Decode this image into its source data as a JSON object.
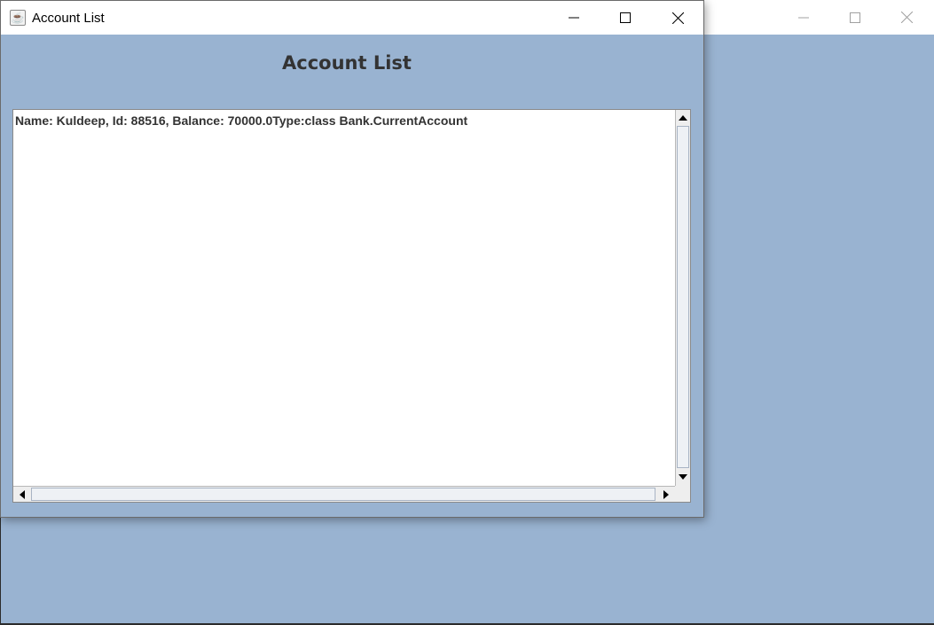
{
  "background_window": {
    "controls": [
      "minimize",
      "maximize",
      "close"
    ]
  },
  "window": {
    "title": "Account List",
    "icon": "java-coffee-icon",
    "controls": {
      "minimize_icon": "minimize-icon",
      "maximize_icon": "maximize-icon",
      "close_icon": "close-icon"
    }
  },
  "content": {
    "heading": "Account List",
    "accounts_text": "Name: Kuldeep, Id: 88516, Balance: 70000.0Type:class Bank.CurrentAccount"
  },
  "colors": {
    "panel_background": "#99b3d1",
    "text": "#333333",
    "titlebar": "#ffffff"
  }
}
